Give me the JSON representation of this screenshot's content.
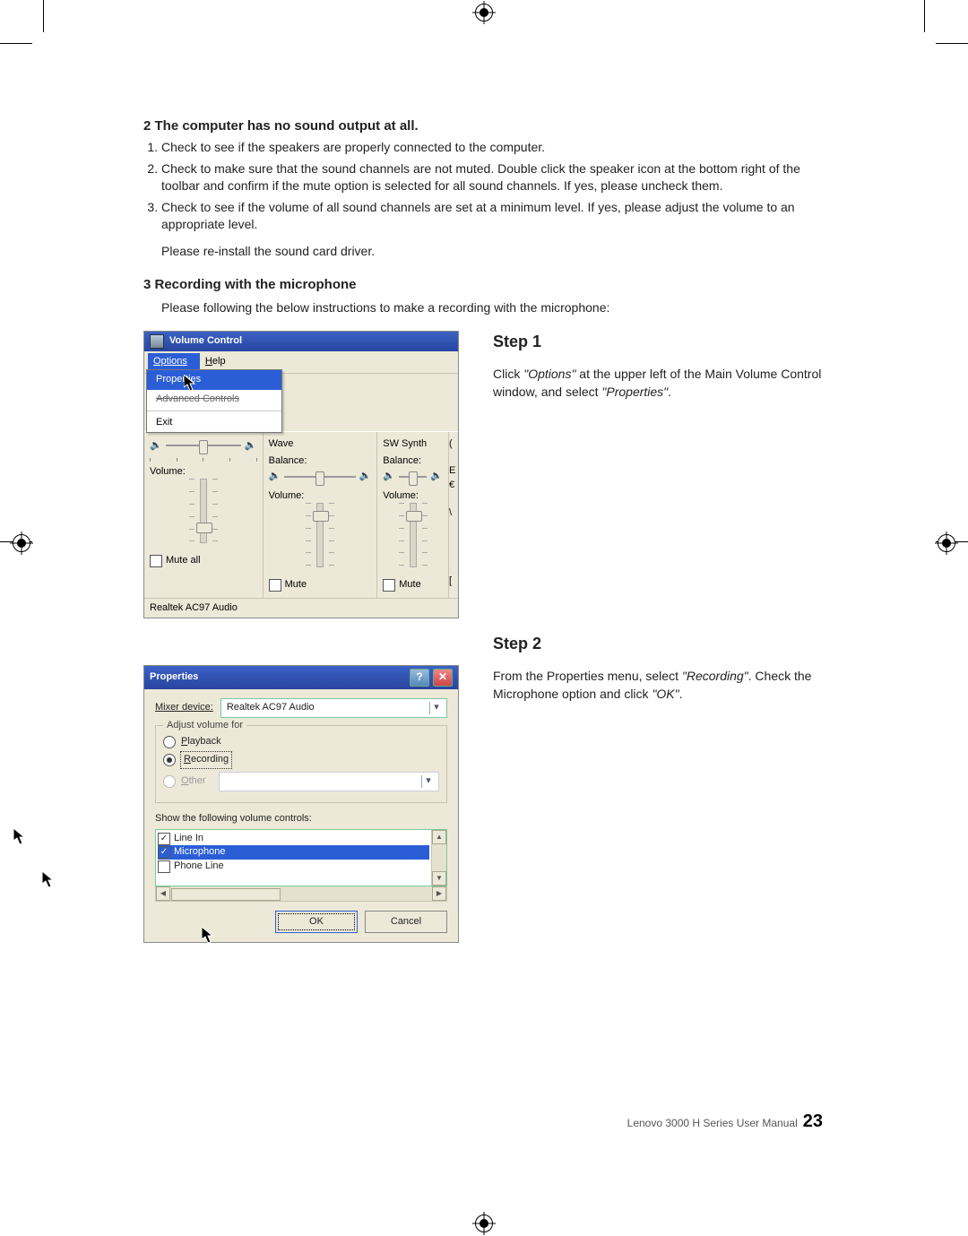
{
  "section_no_sound": {
    "heading": "2 The computer has no sound output at all.",
    "items": [
      "Check to see if the speakers are properly connected to the computer.",
      "Check to make sure that the sound channels are not muted. Double click the speaker icon at the bottom right of the toolbar and confirm if the mute option is selected for all sound channels. If yes, please uncheck them.",
      "Check to see if the volume of all sound channels are set at a minimum level. If yes, please adjust the volume to an appropriate level."
    ],
    "reinstall": "Please re-install the sound card driver."
  },
  "section_recording": {
    "heading": "3 Recording with the microphone",
    "intro": "Please following the below instructions to make a recording with the microphone:"
  },
  "vol_win": {
    "title": "Volume Control",
    "menu": {
      "options": "Options",
      "help": "Help"
    },
    "drop": {
      "properties": "Properties",
      "advanced": "Advanced Controls",
      "exit": "Exit"
    },
    "cols": {
      "wave": "Wave",
      "swsynth": "SW Synth",
      "balance": "Balance:",
      "volume": "Volume:",
      "mute": "Mute",
      "muteall": "Mute all"
    },
    "status": "Realtek AC97 Audio"
  },
  "step1": {
    "title": "Step 1",
    "pre": "Click ",
    "q1": "\"Options\"",
    "mid": " at the upper left of the Main Volume Control window, and select ",
    "q2": "\"Properties\"",
    "end": "."
  },
  "dlg": {
    "title": "Properties",
    "help_btn": "?",
    "close_btn": "✕",
    "mixer_label_pre": "M",
    "mixer_label_rest": "ixer device:",
    "mixer_value": "Realtek AC97 Audio",
    "group_legend": "Adjust volume for",
    "playback_u": "P",
    "playback_rest": "layback",
    "recording_u": "R",
    "recording_rest": "ecording",
    "other_u": "O",
    "other_rest": "ther",
    "list_label": "Show the following volume controls:",
    "list": {
      "linein": "Line In",
      "mic": "Microphone",
      "phone": "Phone Line"
    },
    "ok": "OK",
    "cancel": "Cancel"
  },
  "step2": {
    "title": "Step 2",
    "pre": "From the Properties menu, select ",
    "q1": "\"Recording\"",
    "mid": ". Check the Microphone option and click ",
    "q2": "\"OK\"",
    "end": "."
  },
  "footer": {
    "text": "Lenovo 3000 H Series User Manual",
    "page": "23"
  }
}
